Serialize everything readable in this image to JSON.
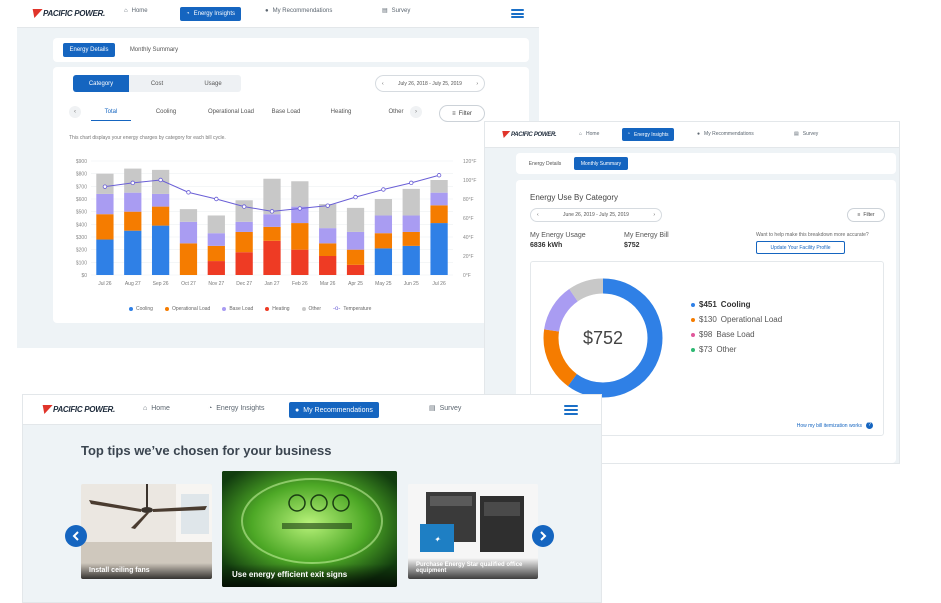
{
  "brand": {
    "logo_text": "PACIFIC POWER."
  },
  "nav": {
    "items": [
      {
        "label": "Home",
        "icon": "home-icon"
      },
      {
        "label": "Energy Insights",
        "icon": "gauge-icon"
      },
      {
        "label": "My Recommendations",
        "icon": "chat-icon"
      },
      {
        "label": "Survey",
        "icon": "survey-icon"
      }
    ]
  },
  "panel1": {
    "tabs": [
      "Energy Details",
      "Monthly Summary"
    ],
    "segments": [
      "Category",
      "Cost",
      "Usage"
    ],
    "date_range": "July 26, 2018 - July 25, 2019",
    "categories": [
      "Total",
      "Cooling",
      "Operational Load",
      "Base Load",
      "Heating",
      "Other"
    ],
    "filter_label": "Filter",
    "description": "This chart displays your energy charges by category for each bill cycle."
  },
  "chart_data": {
    "type": "bar",
    "stacked": true,
    "categories": [
      "Jul 26",
      "Aug 27",
      "Sep 26",
      "Oct 27",
      "Nov 27",
      "Dec 27",
      "Jan 27",
      "Feb 26",
      "Mar 26",
      "Apr 25",
      "May 25",
      "Jun 25",
      "Jul 26"
    ],
    "y_left_ticks": [
      "$0",
      "$100",
      "$200",
      "$300",
      "$400",
      "$500",
      "$600",
      "$700",
      "$800",
      "$900"
    ],
    "y_right_ticks": [
      "0°F",
      "20°F",
      "40°F",
      "60°F",
      "80°F",
      "100°F",
      "120°F"
    ],
    "ylim": [
      0,
      900
    ],
    "y2lim": [
      0,
      120
    ],
    "colors": {
      "Cooling": "#2f80e6",
      "Operational Load": "#f57c00",
      "Base Load": "#a99cf2",
      "Heating": "#ee3b24",
      "Other": "#c8c8c8",
      "Temperature": "#6a5fd6"
    },
    "series": [
      {
        "name": "Cooling",
        "values": [
          280,
          350,
          390,
          0,
          0,
          0,
          0,
          0,
          0,
          0,
          210,
          230,
          410
        ]
      },
      {
        "name": "Heating",
        "values": [
          0,
          0,
          0,
          0,
          110,
          180,
          270,
          200,
          150,
          80,
          0,
          0,
          0
        ]
      },
      {
        "name": "Operational Load",
        "values": [
          200,
          150,
          150,
          250,
          120,
          160,
          110,
          210,
          100,
          120,
          120,
          110,
          140
        ]
      },
      {
        "name": "Base Load",
        "values": [
          160,
          150,
          100,
          170,
          100,
          80,
          100,
          130,
          120,
          140,
          140,
          130,
          100
        ]
      },
      {
        "name": "Other",
        "values": [
          160,
          190,
          190,
          100,
          140,
          170,
          280,
          200,
          190,
          190,
          130,
          210,
          100
        ]
      }
    ],
    "line_series": {
      "name": "Temperature",
      "values": [
        93,
        97,
        100,
        87,
        80,
        72,
        67,
        70,
        73,
        82,
        90,
        97,
        105
      ]
    },
    "legend": [
      "Cooling",
      "Operational Load",
      "Base Load",
      "Heating",
      "Other",
      "Temperature"
    ]
  },
  "panel2": {
    "tabs": [
      "Energy Details",
      "Monthly Summary"
    ],
    "heading": "Energy Use By Category",
    "date_range": "June 26, 2019 - July 25, 2019",
    "filter_label": "Filter",
    "usage_label": "My Energy Usage",
    "usage_value": "6836 kWh",
    "bill_label": "My Energy Bill",
    "bill_value": "$752",
    "help_text": "Want to help make this breakdown more accurate?",
    "profile_button": "Update Your Facility Profile",
    "donut_center": "$752",
    "breakdown": [
      {
        "amount": "$451",
        "label": "Cooling",
        "value": 451,
        "color": "#2f80e6"
      },
      {
        "amount": "$130",
        "label": "Operational Load",
        "value": 130,
        "color": "#f57c00"
      },
      {
        "amount": "$98",
        "label": "Base Load",
        "value": 98,
        "color": "#a99cf2"
      },
      {
        "amount": "$73",
        "label": "Other",
        "value": 73,
        "color": "#c8c8c8"
      }
    ],
    "footer_link": "How my bill itemization works"
  },
  "panel3": {
    "heading": "Top tips we’ve chosen for your business",
    "tips": [
      {
        "label": "Install ceiling fans"
      },
      {
        "label": "Use energy efficient exit signs"
      },
      {
        "label": "Purchase Energy Star qualified office equipment"
      }
    ]
  }
}
